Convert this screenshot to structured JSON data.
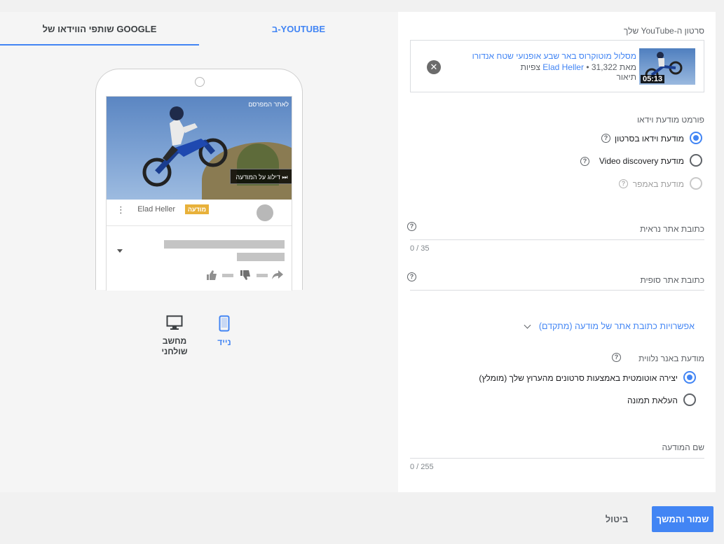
{
  "preview": {
    "tabs": {
      "youtube": "ב-YOUTUBE",
      "google_partners": "שותפי הווידאו של GOOGLE"
    },
    "phone": {
      "advertiser_link": "לאתר המפרסם",
      "skip_label": "דילוג על המודעה ⏭",
      "ad_badge": "מודעה",
      "channel": "Elad Heller"
    },
    "devices": {
      "mobile": "נייד",
      "desktop": "מחשב\nשולחני"
    }
  },
  "form": {
    "video_label": "סרטון ה-YouTube שלך",
    "video": {
      "title": "מסלול מוטוקרוס באר שבע אופנועי שטח אנדורו",
      "meta_prefix": "מאת",
      "channel": "Elad Heller",
      "views": "• 31,322 צפיות",
      "description": "תיאור",
      "duration": "05:13"
    },
    "format_label": "פורמט מודעת וידאו",
    "formats": [
      {
        "label": "מודעת וידאו בסרטון",
        "selected": true,
        "disabled": false
      },
      {
        "label": "מודעת Video discovery",
        "selected": false,
        "disabled": false
      },
      {
        "label": "מודעת באמפר",
        "selected": false,
        "disabled": true
      }
    ],
    "display_url": {
      "placeholder": "כתובת אתר נראית",
      "counter": "0 / 35"
    },
    "final_url": {
      "placeholder": "כתובת אתר סופית"
    },
    "advanced_options": "אפשרויות כתובת אתר של מודעה (מתקדם)",
    "companion_label": "מודעת באנר נלווית",
    "companion_options": [
      {
        "label": "יצירה אוטומטית באמצעות סרטונים מהערוץ שלך (מומלץ)",
        "selected": true
      },
      {
        "label": "העלאת תמונה",
        "selected": false
      }
    ],
    "ad_name": {
      "placeholder": "שם המודעה",
      "counter": "0 / 255"
    },
    "help_glyph": "?"
  },
  "footer": {
    "save_continue": "שמור והמשך",
    "cancel": "ביטול"
  },
  "colors": {
    "accent": "#4285f4",
    "badge": "#e8b13a"
  }
}
